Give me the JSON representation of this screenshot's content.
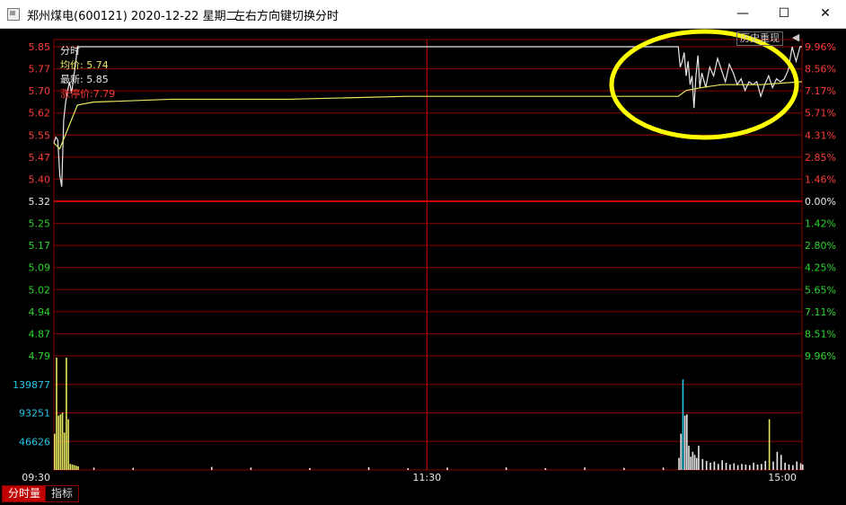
{
  "window": {
    "title": "郑州煤电(600121) 2020-12-22 星期二",
    "hint": "左右方向键切换分时",
    "minimize": "—",
    "maximize": "☐",
    "close": "✕"
  },
  "legend": {
    "label_fenshi": "分时",
    "avg_label": "均价: 5.74",
    "latest_label": "最新: 5.85",
    "limit_label": "涨停价:7.79"
  },
  "history_button": "历史重现",
  "back_icon": "back-arrow-icon",
  "tabs": {
    "volume": "分时量",
    "indicator": "指标"
  },
  "colors": {
    "up": "#ff3b3b",
    "down": "#2bd62b",
    "price": "#e8e8e8",
    "avg": "#e8e860",
    "grid": "#8b0000",
    "highlight": "#ffff00",
    "volume_axis": "#22c3e6"
  },
  "chart_data": {
    "type": "line",
    "prev_close": 5.32,
    "price_ticks_up": [
      "5.85",
      "5.77",
      "5.70",
      "5.62",
      "5.55",
      "5.47",
      "5.40"
    ],
    "price_tick_mid": "5.32",
    "price_ticks_down": [
      "5.25",
      "5.17",
      "5.09",
      "5.02",
      "4.94",
      "4.87",
      "4.79"
    ],
    "pct_ticks_up": [
      "9.96%",
      "8.56%",
      "7.17%",
      "5.71%",
      "4.31%",
      "2.85%",
      "1.46%"
    ],
    "pct_tick_mid": "0.00%",
    "pct_ticks_down": [
      "1.42%",
      "2.80%",
      "4.25%",
      "5.65%",
      "7.11%",
      "8.51%",
      "9.96%"
    ],
    "volume_ticks": [
      "139877",
      "93251",
      "46626"
    ],
    "time_labels": [
      "09:30",
      "11:30",
      "15:00"
    ],
    "price_series": [
      [
        0,
        5.52
      ],
      [
        1,
        5.54
      ],
      [
        2,
        5.53
      ],
      [
        3,
        5.41
      ],
      [
        4,
        5.37
      ],
      [
        5,
        5.6
      ],
      [
        6,
        5.66
      ],
      [
        7,
        5.7
      ],
      [
        8,
        5.73
      ],
      [
        9,
        5.69
      ],
      [
        10,
        5.74
      ],
      [
        11,
        5.79
      ],
      [
        12,
        5.85
      ],
      [
        13,
        5.85
      ],
      [
        60,
        5.85
      ],
      [
        120,
        5.85
      ],
      [
        180,
        5.85
      ],
      [
        240,
        5.85
      ],
      [
        300,
        5.85
      ],
      [
        318,
        5.85
      ],
      [
        319,
        5.78
      ],
      [
        320,
        5.8
      ],
      [
        321,
        5.83
      ],
      [
        322,
        5.75
      ],
      [
        323,
        5.8
      ],
      [
        324,
        5.72
      ],
      [
        325,
        5.75
      ],
      [
        326,
        5.64
      ],
      [
        327,
        5.75
      ],
      [
        328,
        5.82
      ],
      [
        329,
        5.71
      ],
      [
        330,
        5.76
      ],
      [
        332,
        5.71
      ],
      [
        334,
        5.78
      ],
      [
        336,
        5.75
      ],
      [
        338,
        5.81
      ],
      [
        340,
        5.77
      ],
      [
        342,
        5.73
      ],
      [
        344,
        5.79
      ],
      [
        346,
        5.76
      ],
      [
        348,
        5.72
      ],
      [
        350,
        5.74
      ],
      [
        352,
        5.7
      ],
      [
        354,
        5.73
      ],
      [
        356,
        5.72
      ],
      [
        358,
        5.73
      ],
      [
        360,
        5.68
      ],
      [
        362,
        5.72
      ],
      [
        364,
        5.75
      ],
      [
        366,
        5.71
      ],
      [
        368,
        5.74
      ],
      [
        370,
        5.73
      ],
      [
        372,
        5.74
      ],
      [
        374,
        5.77
      ],
      [
        376,
        5.85
      ],
      [
        378,
        5.8
      ],
      [
        380,
        5.85
      ],
      [
        381,
        5.85
      ]
    ],
    "avg_series": [
      [
        0,
        5.52
      ],
      [
        3,
        5.5
      ],
      [
        6,
        5.55
      ],
      [
        9,
        5.6
      ],
      [
        12,
        5.65
      ],
      [
        20,
        5.66
      ],
      [
        60,
        5.67
      ],
      [
        120,
        5.67
      ],
      [
        180,
        5.68
      ],
      [
        240,
        5.68
      ],
      [
        300,
        5.68
      ],
      [
        318,
        5.68
      ],
      [
        322,
        5.7
      ],
      [
        330,
        5.71
      ],
      [
        340,
        5.72
      ],
      [
        360,
        5.72
      ],
      [
        381,
        5.73
      ]
    ],
    "volume_max": 186000,
    "volume": [
      [
        0,
        60000
      ],
      [
        1,
        186000
      ],
      [
        2,
        90000
      ],
      [
        3,
        92000
      ],
      [
        4,
        95000
      ],
      [
        5,
        62000
      ],
      [
        6,
        186000
      ],
      [
        7,
        84000
      ],
      [
        8,
        10000
      ],
      [
        9,
        9000
      ],
      [
        10,
        8000
      ],
      [
        11,
        7000
      ],
      [
        12,
        6000
      ],
      [
        20,
        4000
      ],
      [
        40,
        3500
      ],
      [
        80,
        5000
      ],
      [
        100,
        4000
      ],
      [
        130,
        3000
      ],
      [
        160,
        4500
      ],
      [
        180,
        3000
      ],
      [
        200,
        4000
      ],
      [
        230,
        4200
      ],
      [
        250,
        3000
      ],
      [
        270,
        4000
      ],
      [
        290,
        3500
      ],
      [
        310,
        4000
      ],
      [
        318,
        20000
      ],
      [
        319,
        60000
      ],
      [
        320,
        150000
      ],
      [
        321,
        90000
      ],
      [
        322,
        92000
      ],
      [
        323,
        40000
      ],
      [
        324,
        22000
      ],
      [
        325,
        30000
      ],
      [
        326,
        25000
      ],
      [
        327,
        20000
      ],
      [
        328,
        40000
      ],
      [
        330,
        18000
      ],
      [
        332,
        15000
      ],
      [
        334,
        12000
      ],
      [
        336,
        14000
      ],
      [
        338,
        10000
      ],
      [
        340,
        16000
      ],
      [
        342,
        12000
      ],
      [
        344,
        9000
      ],
      [
        346,
        11000
      ],
      [
        348,
        8000
      ],
      [
        350,
        10000
      ],
      [
        352,
        9000
      ],
      [
        354,
        8000
      ],
      [
        356,
        12000
      ],
      [
        358,
        9000
      ],
      [
        360,
        10000
      ],
      [
        362,
        15000
      ],
      [
        364,
        84000
      ],
      [
        366,
        14000
      ],
      [
        368,
        30000
      ],
      [
        370,
        25000
      ],
      [
        372,
        12000
      ],
      [
        374,
        9000
      ],
      [
        376,
        8000
      ],
      [
        378,
        14000
      ],
      [
        380,
        11000
      ],
      [
        381,
        9000
      ]
    ]
  }
}
